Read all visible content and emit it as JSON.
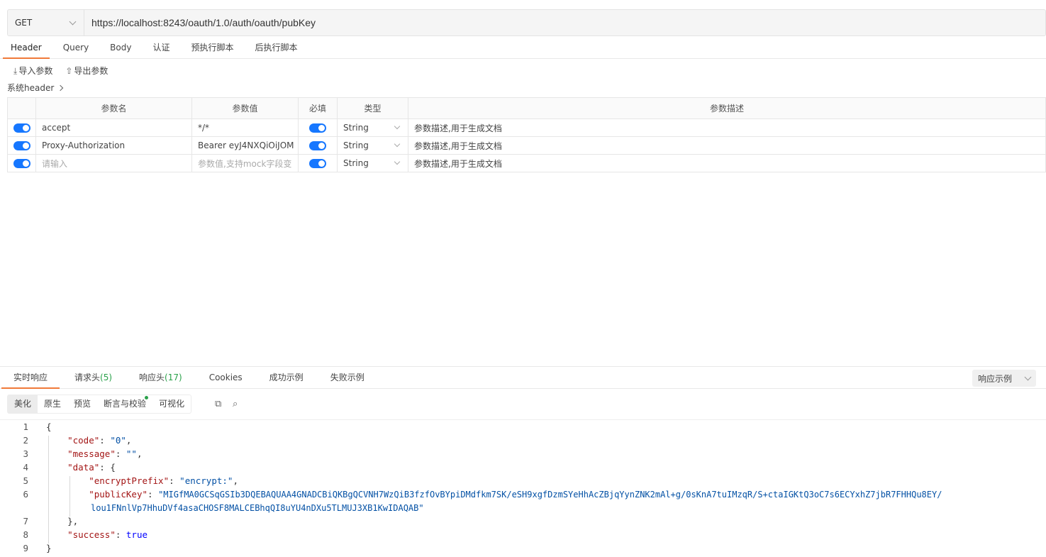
{
  "request": {
    "method": "GET",
    "url": "https://localhost:8243/oauth/1.0/auth/oauth/pubKey"
  },
  "req_tabs": [
    "Header",
    "Query",
    "Body",
    "认证",
    "预执行脚本",
    "后执行脚本"
  ],
  "toolbar": {
    "import": "导入参数",
    "export": "导出参数",
    "sys_header": "系统header"
  },
  "table": {
    "headers": [
      "参数名",
      "参数值",
      "必填",
      "类型",
      "参数描述"
    ],
    "rows": [
      {
        "name": "accept",
        "value": "*/*",
        "type": "String",
        "desc": "参数描述,用于生成文档"
      },
      {
        "name": "Proxy-Authorization",
        "value": "Bearer eyJ4NXQiOiJOM",
        "type": "String",
        "desc": "参数描述,用于生成文档"
      },
      {
        "name": "请输入",
        "value": "参数值,支持mock字段变",
        "type": "String",
        "desc": "参数描述,用于生成文档"
      }
    ]
  },
  "resp_tabs": {
    "realtime": "实时响应",
    "req_headers": "请求头",
    "req_headers_count": "(5)",
    "resp_headers": "响应头",
    "resp_headers_count": "(17)",
    "cookies": "Cookies",
    "success_example": "成功示例",
    "fail_example": "失败示例",
    "resp_example": "响应示例"
  },
  "view_modes": [
    "美化",
    "原生",
    "预览",
    "断言与校验",
    "可视化"
  ],
  "icons": {
    "copy": "copy-icon",
    "search": "search-icon",
    "import": "download-icon",
    "export": "upload-icon"
  },
  "colors": {
    "accent": "#f07a3a",
    "toggle": "#1677ff",
    "green": "#2aa14a"
  },
  "code": {
    "code_key": "\"code\"",
    "code_val": "\"0\"",
    "message_key": "\"message\"",
    "message_val": "\"\"",
    "data_key": "\"data\"",
    "encrypt_key": "\"encryptPrefix\"",
    "encrypt_val": "\"encrypt:\"",
    "pubkey_key": "\"publicKey\"",
    "pubkey_val_1": "\"MIGfMA0GCSqGSIb3DQEBAQUAA4GNADCBiQKBgQCVNH7WzQiB3fzfOvBYpiDMdfkm7SK/eSH9xgfDzmSYeHhAcZBjqYynZNK2mAl+g/0sKnA7tuIMzqR/S+ctaIGKtQ3oC7s6ECYxhZ7jbR7FHHQu8EY/",
    "pubkey_val_2": "lou1FNnlVp7HhuDVf4asaCHOSF8MALCEBhqQI8uYU4nDXu5TLMUJ3XB1KwIDAQAB\"",
    "success_key": "\"success\"",
    "success_val": "true"
  }
}
